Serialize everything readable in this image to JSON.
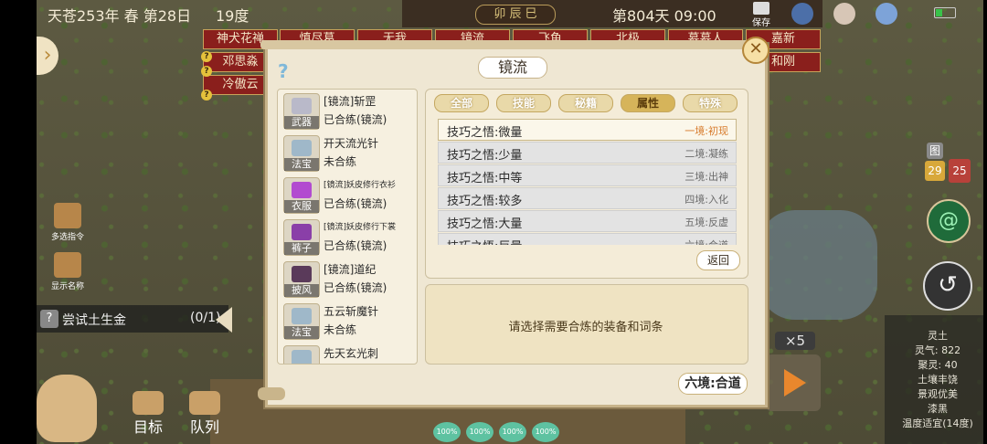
{
  "hud": {
    "date": "天苍253年 春 第28日",
    "temperature": "19度",
    "hour": "卯 辰 巳",
    "day_time": "第804天 09:00",
    "save_label": "保存"
  },
  "character_tabs": [
    "神犬花禅",
    "邓思淼",
    "冷傲云",
    "慎尽葛",
    "无我",
    "镜流",
    "飞鱼",
    "北极",
    "慕慕人",
    "嘉新",
    "和刚"
  ],
  "left_controls": {
    "multi_select": "多选指令",
    "show_names": "显示名称",
    "quest_text": "尝试土生金",
    "quest_count": "(0/1)",
    "goal": "目标",
    "queue": "队列"
  },
  "modal": {
    "title": "镜流",
    "help": "?",
    "close": "✕",
    "items": [
      {
        "name": "[镜流]斩罡",
        "type": "武器",
        "status": "已合练(镜流)",
        "small": false,
        "color": "#b9b9c9"
      },
      {
        "name": "开天流光针",
        "type": "法宝",
        "status": "未合练",
        "small": false,
        "color": "#9fb8c9"
      },
      {
        "name": "[镜流]妖皮修行衣衫",
        "type": "衣服",
        "status": "已合练(镜流)",
        "small": true,
        "color": "#b24bd0"
      },
      {
        "name": "[镜流]妖皮修行下裳",
        "type": "裤子",
        "status": "已合练(镜流)",
        "small": true,
        "color": "#8a3fa8"
      },
      {
        "name": "[镜流]道纪",
        "type": "披风",
        "status": "已合练(镜流)",
        "small": false,
        "color": "#5a3a5a"
      },
      {
        "name": "五云斩魔针",
        "type": "法宝",
        "status": "未合练",
        "small": false,
        "color": "#9fb8c9"
      },
      {
        "name": "先天玄光刺",
        "type": "法宝",
        "status": "",
        "small": false,
        "color": "#9fb8c9"
      }
    ],
    "filter_tabs": [
      "全部",
      "技能",
      "秘籍",
      "属性",
      "特殊"
    ],
    "active_tab": "属性",
    "attributes": [
      {
        "name": "技巧之悟:微量",
        "level": "一境:初现"
      },
      {
        "name": "技巧之悟:少量",
        "level": "二境:凝练"
      },
      {
        "name": "技巧之悟:中等",
        "level": "三境:出神"
      },
      {
        "name": "技巧之悟:较多",
        "level": "四境:入化"
      },
      {
        "name": "技巧之悟:大量",
        "level": "五境:反虚"
      },
      {
        "name": "技巧之悟:巨量",
        "level": "六境:合道"
      }
    ],
    "back_label": "返回",
    "hint": "请选择需要合炼的装备和词条",
    "realm_label": "六境:合道"
  },
  "right_controls": {
    "badge_top": "图",
    "badge_left": "29",
    "badge_right": "25",
    "badge_colors": {
      "top": "#8a8a8a",
      "left": "#d8a83a",
      "right": "#b8413a"
    },
    "speed": "×5",
    "info": [
      "灵土",
      "灵气: 822",
      "聚灵: 40",
      "土壤丰饶",
      "景观优美",
      "漆黑",
      "温度适宜(14度)"
    ]
  },
  "bottom_bar": [
    "100%",
    "100%",
    "100%",
    "100%"
  ]
}
